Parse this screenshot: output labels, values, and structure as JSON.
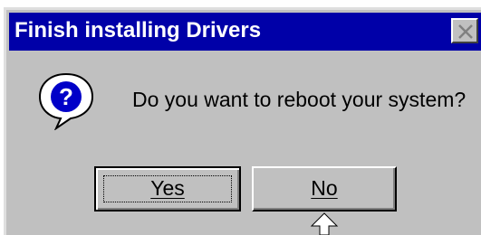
{
  "window": {
    "title": "Finish installing Drivers",
    "close_icon": "close-icon"
  },
  "dialog": {
    "icon": "question-icon",
    "message": "Do you want to reboot your system?"
  },
  "buttons": {
    "yes_label": "Yes",
    "no_label": "No"
  },
  "pointer": {
    "icon": "arrow-up-icon"
  },
  "colors": {
    "title_bar": "#0000a8",
    "face": "#c0c0c0",
    "title_text": "#ffffff"
  }
}
